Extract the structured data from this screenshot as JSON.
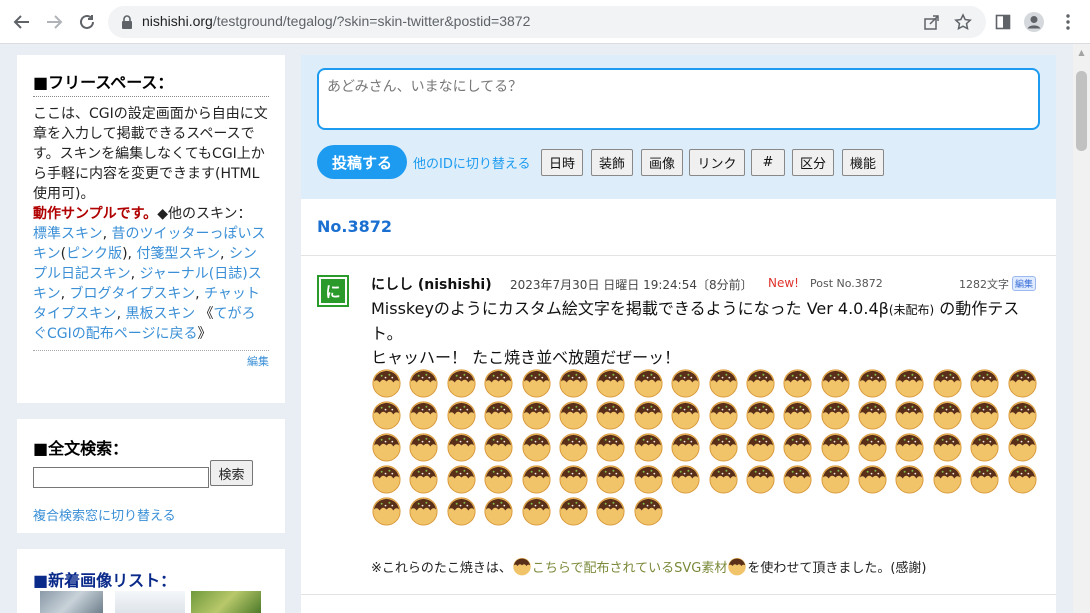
{
  "browser": {
    "url_domain": "nishishi.org",
    "url_path": "/testground/tegalog/?skin=skin-twitter&postid=3872"
  },
  "sidebar": {
    "free_space": {
      "title": "■フリースペース：",
      "text_intro": "ここは、CGIの設定画面から自由に文章を入力して掲載できるスペースです。スキンを編集しなくてもCGI上から手軽に内容を変更できます(HTML使用可)。",
      "demo_label": "動作サンプルです。",
      "other_skins_label": "◆他のスキン：",
      "skins": [
        {
          "label": "標準スキン",
          "sep": ", "
        },
        {
          "label": "昔のツイッターっぽいスキン",
          "sep": "("
        },
        {
          "label": "ピンク版",
          "sep": "), "
        },
        {
          "label": "付箋型スキン",
          "sep": ", "
        },
        {
          "label": "シンプル日記スキン",
          "sep": ", "
        },
        {
          "label": "ジャーナル(日誌)スキン",
          "sep": ", "
        },
        {
          "label": "ブログタイプスキン",
          "sep": ", "
        },
        {
          "label": "チャットタイプスキン",
          "sep": ", "
        },
        {
          "label": "黒板スキン",
          "sep": ""
        }
      ],
      "distribution_open": "《",
      "distribution_link": "てがろぐCGIの配布ページに戻る",
      "distribution_close": "》",
      "edit_label": "編集"
    },
    "search": {
      "title": "■全文検索：",
      "button_label": "検索",
      "switch_label": "複合検索窓に切り替える"
    },
    "images": {
      "title": "■新着画像リスト："
    }
  },
  "composer": {
    "placeholder": "あどみさん、いまなにしてる？",
    "post_button": "投稿する",
    "switch_id": "他のIDに切り替える",
    "tools": [
      "日時",
      "装飾",
      "画像",
      "リンク",
      "#",
      "区分",
      "機能"
    ]
  },
  "post": {
    "heading": "No.3872",
    "author": "にしし (nishishi)",
    "avatar_char": "に",
    "date": "2023年7月30日 日曜日 19:24:54〔8分前〕",
    "new_label": "New!",
    "post_no": "Post No.3872",
    "char_count": "1282文字",
    "edit_badge": "編集",
    "body_line1_a": "Misskeyのようにカスタム絵文字を掲載できるようになった Ver 4.0.4β",
    "body_line1_small": "(未配布)",
    "body_line1_b": " の動作テスト。",
    "body_line2": "ヒャッハー！ たこ焼き並べ放題だぜーッ！",
    "emoji_count": 80,
    "emoji_name": "takoyaki-emoji",
    "footnote_a": "※これらのたこ焼きは、",
    "footnote_link": "こちらで配布されているSVG素材",
    "footnote_b": "を使わせて頂きました。(感謝)"
  },
  "colors": {
    "accent": "#1d9bf0",
    "link": "#3a8fd6",
    "heading_blue": "#1a6fd1",
    "new_red": "#e0332d",
    "composer_bg": "#ddeefa",
    "page_bg": "#e8eef3"
  }
}
